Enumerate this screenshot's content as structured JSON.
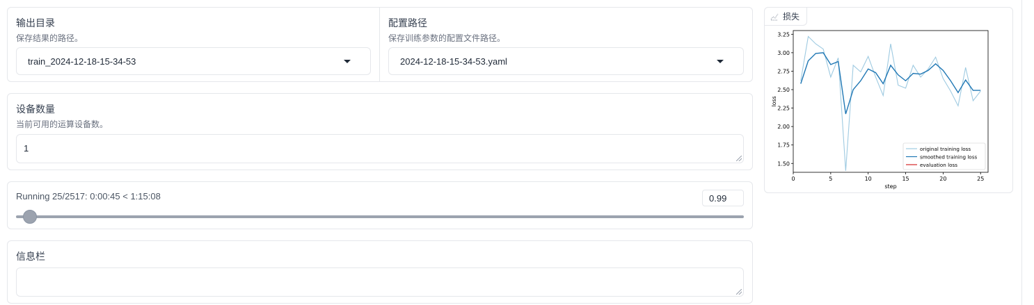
{
  "output_dir": {
    "label": "输出目录",
    "info": "保存结果的路径。",
    "value": "train_2024-12-18-15-34-53"
  },
  "config_path": {
    "label": "配置路径",
    "info": "保存训练参数的配置文件路径。",
    "value": "2024-12-18-15-34-53.yaml"
  },
  "device_count": {
    "label": "设备数量",
    "info": "当前可用的运算设备数。",
    "value": "1"
  },
  "progress": {
    "text": "Running 25/2517: 0:00:45 < 1:15:08",
    "fraction": 0.0099,
    "value": "0.99"
  },
  "info_box": {
    "label": "信息栏",
    "value": ""
  },
  "plot": {
    "tab_label": "损失",
    "tab_icon": "chart-icon"
  },
  "chart_data": {
    "type": "line",
    "title": "",
    "xlabel": "step",
    "ylabel": "loss",
    "xlim": [
      0,
      26
    ],
    "ylim": [
      1.38,
      3.3
    ],
    "xticks": [
      0,
      5,
      10,
      15,
      20,
      25
    ],
    "yticks": [
      1.5,
      1.75,
      2.0,
      2.25,
      2.5,
      2.75,
      3.0,
      3.25
    ],
    "legend_position": "lower-right",
    "series": [
      {
        "name": "original training loss",
        "color": "#9ecae1",
        "x": [
          1,
          2,
          3,
          4,
          5,
          6,
          7,
          8,
          9,
          10,
          11,
          12,
          13,
          14,
          15,
          16,
          17,
          18,
          19,
          20,
          21,
          22,
          23,
          24,
          25
        ],
        "y": [
          2.62,
          3.22,
          3.12,
          3.05,
          2.67,
          2.93,
          1.4,
          2.83,
          2.74,
          2.95,
          2.67,
          2.42,
          3.12,
          2.56,
          2.52,
          2.83,
          2.67,
          2.78,
          2.94,
          2.65,
          2.48,
          2.28,
          2.8,
          2.35,
          2.48
        ]
      },
      {
        "name": "smoothed training loss",
        "color": "#1f77b4",
        "x": [
          1,
          2,
          3,
          4,
          5,
          6,
          7,
          8,
          9,
          10,
          11,
          12,
          13,
          14,
          15,
          16,
          17,
          18,
          19,
          20,
          21,
          22,
          23,
          24,
          25
        ],
        "y": [
          2.58,
          2.89,
          2.99,
          3.0,
          2.84,
          2.88,
          2.17,
          2.5,
          2.62,
          2.78,
          2.73,
          2.58,
          2.83,
          2.7,
          2.62,
          2.72,
          2.71,
          2.76,
          2.85,
          2.76,
          2.62,
          2.46,
          2.63,
          2.49,
          2.49
        ]
      },
      {
        "name": "evaluation loss",
        "color": "#d62728",
        "x": [],
        "y": []
      }
    ]
  }
}
